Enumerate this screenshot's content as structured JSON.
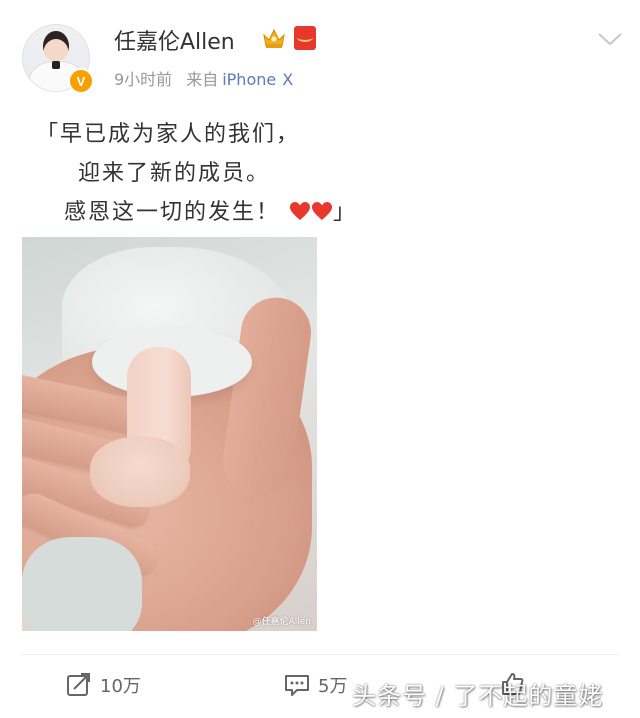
{
  "post": {
    "username": "任嘉伦Allen",
    "time": "9小时前",
    "source_prefix": "来自",
    "device": "iPhone",
    "device_suffix": "X",
    "verified_badge": "V",
    "lines": [
      "「早已成为家人的我们，",
      "迎来了新的成员。",
      "感恩这一切的发生！",
      "」"
    ],
    "image_watermark": "@任嘉伦Allen",
    "icons": [
      "crown-icon",
      "red-packet-icon",
      "chevron-down-icon",
      "repost-icon",
      "comment-icon",
      "like-icon",
      "heart-icon"
    ],
    "colors": {
      "link": "#5b7bb4",
      "badge": "#f7a000",
      "heart": "#e8382d"
    }
  },
  "actions": {
    "repost_count": "10万",
    "comment_count": "5万",
    "like_count": ""
  },
  "overlay_watermark": "头条号 / 了不起的童姥"
}
